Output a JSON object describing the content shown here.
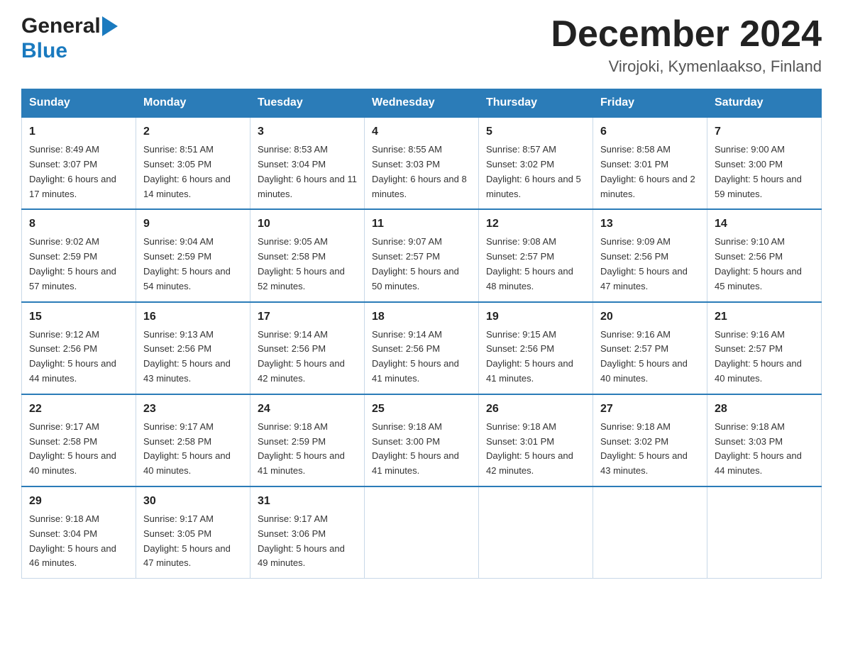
{
  "header": {
    "logo_line1_black": "General",
    "logo_line1_blue_arrow": "▶",
    "logo_line2": "Blue",
    "title": "December 2024",
    "subtitle": "Virojoki, Kymenlaakso, Finland"
  },
  "days_of_week": [
    "Sunday",
    "Monday",
    "Tuesday",
    "Wednesday",
    "Thursday",
    "Friday",
    "Saturday"
  ],
  "weeks": [
    [
      {
        "day": "1",
        "sunrise": "Sunrise: 8:49 AM",
        "sunset": "Sunset: 3:07 PM",
        "daylight": "Daylight: 6 hours and 17 minutes."
      },
      {
        "day": "2",
        "sunrise": "Sunrise: 8:51 AM",
        "sunset": "Sunset: 3:05 PM",
        "daylight": "Daylight: 6 hours and 14 minutes."
      },
      {
        "day": "3",
        "sunrise": "Sunrise: 8:53 AM",
        "sunset": "Sunset: 3:04 PM",
        "daylight": "Daylight: 6 hours and 11 minutes."
      },
      {
        "day": "4",
        "sunrise": "Sunrise: 8:55 AM",
        "sunset": "Sunset: 3:03 PM",
        "daylight": "Daylight: 6 hours and 8 minutes."
      },
      {
        "day": "5",
        "sunrise": "Sunrise: 8:57 AM",
        "sunset": "Sunset: 3:02 PM",
        "daylight": "Daylight: 6 hours and 5 minutes."
      },
      {
        "day": "6",
        "sunrise": "Sunrise: 8:58 AM",
        "sunset": "Sunset: 3:01 PM",
        "daylight": "Daylight: 6 hours and 2 minutes."
      },
      {
        "day": "7",
        "sunrise": "Sunrise: 9:00 AM",
        "sunset": "Sunset: 3:00 PM",
        "daylight": "Daylight: 5 hours and 59 minutes."
      }
    ],
    [
      {
        "day": "8",
        "sunrise": "Sunrise: 9:02 AM",
        "sunset": "Sunset: 2:59 PM",
        "daylight": "Daylight: 5 hours and 57 minutes."
      },
      {
        "day": "9",
        "sunrise": "Sunrise: 9:04 AM",
        "sunset": "Sunset: 2:59 PM",
        "daylight": "Daylight: 5 hours and 54 minutes."
      },
      {
        "day": "10",
        "sunrise": "Sunrise: 9:05 AM",
        "sunset": "Sunset: 2:58 PM",
        "daylight": "Daylight: 5 hours and 52 minutes."
      },
      {
        "day": "11",
        "sunrise": "Sunrise: 9:07 AM",
        "sunset": "Sunset: 2:57 PM",
        "daylight": "Daylight: 5 hours and 50 minutes."
      },
      {
        "day": "12",
        "sunrise": "Sunrise: 9:08 AM",
        "sunset": "Sunset: 2:57 PM",
        "daylight": "Daylight: 5 hours and 48 minutes."
      },
      {
        "day": "13",
        "sunrise": "Sunrise: 9:09 AM",
        "sunset": "Sunset: 2:56 PM",
        "daylight": "Daylight: 5 hours and 47 minutes."
      },
      {
        "day": "14",
        "sunrise": "Sunrise: 9:10 AM",
        "sunset": "Sunset: 2:56 PM",
        "daylight": "Daylight: 5 hours and 45 minutes."
      }
    ],
    [
      {
        "day": "15",
        "sunrise": "Sunrise: 9:12 AM",
        "sunset": "Sunset: 2:56 PM",
        "daylight": "Daylight: 5 hours and 44 minutes."
      },
      {
        "day": "16",
        "sunrise": "Sunrise: 9:13 AM",
        "sunset": "Sunset: 2:56 PM",
        "daylight": "Daylight: 5 hours and 43 minutes."
      },
      {
        "day": "17",
        "sunrise": "Sunrise: 9:14 AM",
        "sunset": "Sunset: 2:56 PM",
        "daylight": "Daylight: 5 hours and 42 minutes."
      },
      {
        "day": "18",
        "sunrise": "Sunrise: 9:14 AM",
        "sunset": "Sunset: 2:56 PM",
        "daylight": "Daylight: 5 hours and 41 minutes."
      },
      {
        "day": "19",
        "sunrise": "Sunrise: 9:15 AM",
        "sunset": "Sunset: 2:56 PM",
        "daylight": "Daylight: 5 hours and 41 minutes."
      },
      {
        "day": "20",
        "sunrise": "Sunrise: 9:16 AM",
        "sunset": "Sunset: 2:57 PM",
        "daylight": "Daylight: 5 hours and 40 minutes."
      },
      {
        "day": "21",
        "sunrise": "Sunrise: 9:16 AM",
        "sunset": "Sunset: 2:57 PM",
        "daylight": "Daylight: 5 hours and 40 minutes."
      }
    ],
    [
      {
        "day": "22",
        "sunrise": "Sunrise: 9:17 AM",
        "sunset": "Sunset: 2:58 PM",
        "daylight": "Daylight: 5 hours and 40 minutes."
      },
      {
        "day": "23",
        "sunrise": "Sunrise: 9:17 AM",
        "sunset": "Sunset: 2:58 PM",
        "daylight": "Daylight: 5 hours and 40 minutes."
      },
      {
        "day": "24",
        "sunrise": "Sunrise: 9:18 AM",
        "sunset": "Sunset: 2:59 PM",
        "daylight": "Daylight: 5 hours and 41 minutes."
      },
      {
        "day": "25",
        "sunrise": "Sunrise: 9:18 AM",
        "sunset": "Sunset: 3:00 PM",
        "daylight": "Daylight: 5 hours and 41 minutes."
      },
      {
        "day": "26",
        "sunrise": "Sunrise: 9:18 AM",
        "sunset": "Sunset: 3:01 PM",
        "daylight": "Daylight: 5 hours and 42 minutes."
      },
      {
        "day": "27",
        "sunrise": "Sunrise: 9:18 AM",
        "sunset": "Sunset: 3:02 PM",
        "daylight": "Daylight: 5 hours and 43 minutes."
      },
      {
        "day": "28",
        "sunrise": "Sunrise: 9:18 AM",
        "sunset": "Sunset: 3:03 PM",
        "daylight": "Daylight: 5 hours and 44 minutes."
      }
    ],
    [
      {
        "day": "29",
        "sunrise": "Sunrise: 9:18 AM",
        "sunset": "Sunset: 3:04 PM",
        "daylight": "Daylight: 5 hours and 46 minutes."
      },
      {
        "day": "30",
        "sunrise": "Sunrise: 9:17 AM",
        "sunset": "Sunset: 3:05 PM",
        "daylight": "Daylight: 5 hours and 47 minutes."
      },
      {
        "day": "31",
        "sunrise": "Sunrise: 9:17 AM",
        "sunset": "Sunset: 3:06 PM",
        "daylight": "Daylight: 5 hours and 49 minutes."
      },
      null,
      null,
      null,
      null
    ]
  ]
}
